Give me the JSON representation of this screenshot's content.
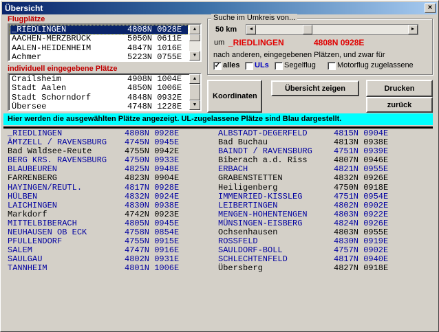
{
  "window": {
    "title": "Übersicht",
    "close_glyph": "×"
  },
  "flugplaetze": {
    "label": "Flugplätze",
    "rows": [
      {
        "name": "_RIEDLINGEN",
        "coords": "4808N 0928E",
        "selected": true
      },
      {
        "name": "AACHEN-MERZBRÜCK",
        "coords": "5050N 0611E",
        "selected": false
      },
      {
        "name": "AALEN-HEIDENHEIM",
        "coords": "4847N 1016E",
        "selected": false
      },
      {
        "name": "Achmer",
        "coords": "5223N 0755E",
        "selected": false
      }
    ]
  },
  "individuell": {
    "label": "individuell eingegebene Plätze",
    "rows": [
      {
        "name": "Crailsheim",
        "coords": "4908N 1004E"
      },
      {
        "name": "Stadt Aalen",
        "coords": "4850N 1006E"
      },
      {
        "name": "Stadt Schorndorf",
        "coords": "4848N 0932E"
      },
      {
        "name": "Übersee",
        "coords": "4748N 1228E"
      }
    ]
  },
  "search": {
    "title": "Suche im Umkreis von...",
    "radius": "50 km",
    "slider_fraction": 0.33,
    "um_label": "um",
    "center_name": "_RIEDLINGEN",
    "center_coords": "4808N 0928E",
    "description": "nach anderen, eingegebenen Plätzen, und zwar für",
    "filters": [
      {
        "label": "alles",
        "checked": true,
        "color": "#000000",
        "bold": true
      },
      {
        "label": "ULs",
        "checked": false,
        "color": "#0000c0",
        "bold": true
      },
      {
        "label": "Segelflug",
        "checked": false,
        "color": "#000000",
        "bold": false
      },
      {
        "label": "Motorflug zugelassene",
        "checked": false,
        "color": "#000000",
        "bold": false
      }
    ]
  },
  "buttons": {
    "koordinaten": "Koordinaten",
    "uebersicht": "Übersicht zeigen",
    "drucken": "Drucken",
    "zurueck": "zurück"
  },
  "info": "Hier werden die ausgewählten Plätze angezeigt. UL-zugelassene Plätze sind Blau dargestellt.",
  "results": {
    "left": [
      {
        "name": "_RIEDLINGEN",
        "coords": "4808N 0928E",
        "ul": true
      },
      {
        "name": "ÄMTZELL / RAVENSBURG",
        "coords": "4745N 0945E",
        "ul": true
      },
      {
        "name": "Bad Waldsee-Reute",
        "coords": "4755N 0942E",
        "ul": false
      },
      {
        "name": "BERG KRS. RAVENSBURG",
        "coords": "4750N 0933E",
        "ul": true
      },
      {
        "name": "BLAUBEUREN",
        "coords": "4825N 0948E",
        "ul": true
      },
      {
        "name": "FARRENBERG",
        "coords": "4823N 0904E",
        "ul": false
      },
      {
        "name": "HAYINGEN/REUTL.",
        "coords": "4817N 0928E",
        "ul": true
      },
      {
        "name": "HÜLBEN",
        "coords": "4832N 0924E",
        "ul": true
      },
      {
        "name": "LAICHINGEN",
        "coords": "4830N 0938E",
        "ul": true
      },
      {
        "name": "Markdorf",
        "coords": "4742N 0923E",
        "ul": false
      },
      {
        "name": "MITTELBIBERACH",
        "coords": "4805N 0945E",
        "ul": true
      },
      {
        "name": "NEUHAUSEN OB ECK",
        "coords": "4758N 0854E",
        "ul": true
      },
      {
        "name": "PFULLENDORF",
        "coords": "4755N 0915E",
        "ul": true
      },
      {
        "name": "SALEM",
        "coords": "4747N 0916E",
        "ul": true
      },
      {
        "name": "SAULGAU",
        "coords": "4802N 0931E",
        "ul": true
      },
      {
        "name": "TANNHEIM",
        "coords": "4801N 1006E",
        "ul": true
      }
    ],
    "right": [
      {
        "name": "ALBSTADT-DEGERFELD",
        "coords": "4815N 0904E",
        "ul": true
      },
      {
        "name": "Bad Buchau",
        "coords": "4813N 0938E",
        "ul": false
      },
      {
        "name": "BAINDT / RAVENSBURG",
        "coords": "4751N 0939E",
        "ul": true
      },
      {
        "name": "Biberach a.d. Riss",
        "coords": "4807N 0946E",
        "ul": false
      },
      {
        "name": "ERBACH",
        "coords": "4821N 0955E",
        "ul": true
      },
      {
        "name": "GRABENSTETTEN",
        "coords": "4832N 0926E",
        "ul": false
      },
      {
        "name": "Heiligenberg",
        "coords": "4750N 0918E",
        "ul": false
      },
      {
        "name": "IMMENRIED-KISSLEG",
        "coords": "4751N 0954E",
        "ul": true
      },
      {
        "name": "LEIBERTINGEN",
        "coords": "4802N 0902E",
        "ul": true
      },
      {
        "name": "MENGEN-HOHENTENGEN",
        "coords": "4803N 0922E",
        "ul": true
      },
      {
        "name": "MÜNSINGEN-EISBERG",
        "coords": "4824N 0926E",
        "ul": true
      },
      {
        "name": "Ochsenhausen",
        "coords": "4803N 0955E",
        "ul": false
      },
      {
        "name": "ROSSFELD",
        "coords": "4830N 0919E",
        "ul": true
      },
      {
        "name": "SAULDORF-BOLL",
        "coords": "4757N 0902E",
        "ul": true
      },
      {
        "name": "SCHLECHTENFELD",
        "coords": "4817N 0940E",
        "ul": true
      },
      {
        "name": "Übersberg",
        "coords": "4827N 0918E",
        "ul": false
      }
    ]
  }
}
